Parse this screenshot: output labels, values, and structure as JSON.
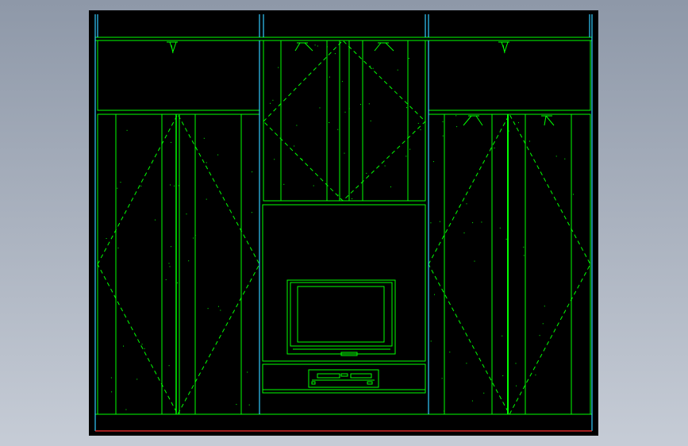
{
  "drawing": {
    "background": "#000000",
    "line_color": "#00ff00",
    "edge_color": "#33ccff",
    "floor_color": "#ff3030",
    "window_bg": "#8e98a8"
  },
  "icons": {
    "tv": "television-icon",
    "vcr": "video-player-icon",
    "light": "spotlight-icon"
  }
}
